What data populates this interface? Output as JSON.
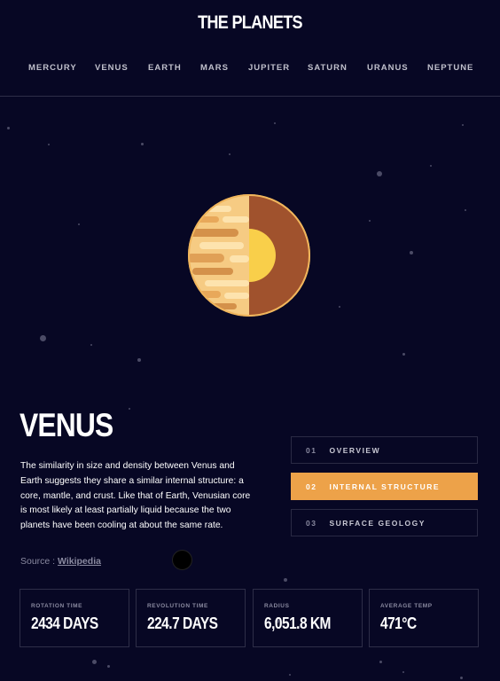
{
  "header": {
    "logo": "THE PLANETS"
  },
  "nav": {
    "items": [
      "MERCURY",
      "VENUS",
      "EARTH",
      "MARS",
      "JUPITER",
      "SATURN",
      "URANUS",
      "NEPTUNE"
    ]
  },
  "planet": {
    "name": "VENUS",
    "description": "The similarity in size and density between Venus and Earth suggests they share a similar internal structure: a core, mantle, and crust. Like that of Earth, Venusian core is most likely at least partially liquid because the two planets have been cooling at about the same rate.",
    "source_prefix": "Source : ",
    "source_link": "Wikipedia",
    "image_icon": "venus-internal-structure-icon"
  },
  "tabs": [
    {
      "num": "01",
      "label": "OVERVIEW",
      "active": false
    },
    {
      "num": "02",
      "label": "INTERNAL STRUCTURE",
      "active": true
    },
    {
      "num": "03",
      "label": "SURFACE GEOLOGY",
      "active": false
    }
  ],
  "stats": [
    {
      "label": "ROTATION TIME",
      "value": "2434 DAYS"
    },
    {
      "label": "REVOLUTION TIME",
      "value": "224.7 DAYS"
    },
    {
      "label": "RADIUS",
      "value": "6,051.8 KM"
    },
    {
      "label": "AVERAGE TEMP",
      "value": "471°C"
    }
  ],
  "colors": {
    "background": "#070724",
    "accent": "#EDA249",
    "venus_light": "#F9C97A",
    "venus_dark": "#A0522D",
    "core": "#F9CF4A"
  }
}
